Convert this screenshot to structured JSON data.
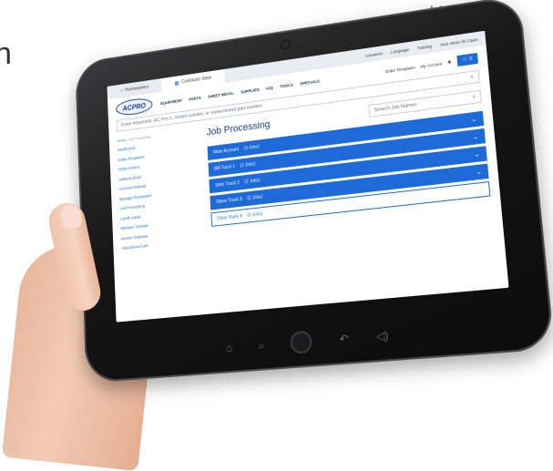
{
  "edge_text": "n",
  "dots": "• • •",
  "browser": {
    "tabs": [
      {
        "label": "Homeowners",
        "icon": "house-icon"
      },
      {
        "label": "Contractor Store",
        "icon": "store-icon"
      }
    ],
    "toplinks": [
      "Locations",
      "Language",
      "Training",
      "Your Store: El Cajon"
    ]
  },
  "header": {
    "logo_text": "ACPRO",
    "nav": [
      "EQUIPMENT",
      "PARTS",
      "SHEET METAL",
      "SUPPLIES",
      "IAQ",
      "TOOLS",
      "SPECIALS"
    ],
    "order_templates": "Order Templates",
    "my_account": "My Account",
    "cart_label": "0"
  },
  "search": {
    "placeholder": "Enter keywords, AC Pro #, model number, or replacement part number"
  },
  "breadcrumb": {
    "home": "Home",
    "current": "Job Processing"
  },
  "sidebar": {
    "items": [
      "Dashboard",
      "Order Templates",
      "Order History",
      "Address Book",
      "Account Settings",
      "Manage Employees",
      "Job Processing",
      "Credit Cards",
      "Website Tutorials",
      "Invoice Gateway",
      "Abandoned Cart"
    ]
  },
  "page": {
    "title": "Job Processing",
    "search_placeholder": "Search Job Names",
    "jobs": [
      {
        "name": "Main Account",
        "count": "(3 Jobs)",
        "open": false
      },
      {
        "name": "Bill Truck 1",
        "count": "(1 Jobs)",
        "open": false
      },
      {
        "name": "John Truck 2",
        "count": "(2 Jobs)",
        "open": false
      },
      {
        "name": "Steve Truck 3",
        "count": "(2 Jobs)",
        "open": false
      },
      {
        "name": "Chris Truck 4",
        "count": "(0 Jobs)",
        "open": true
      }
    ]
  }
}
